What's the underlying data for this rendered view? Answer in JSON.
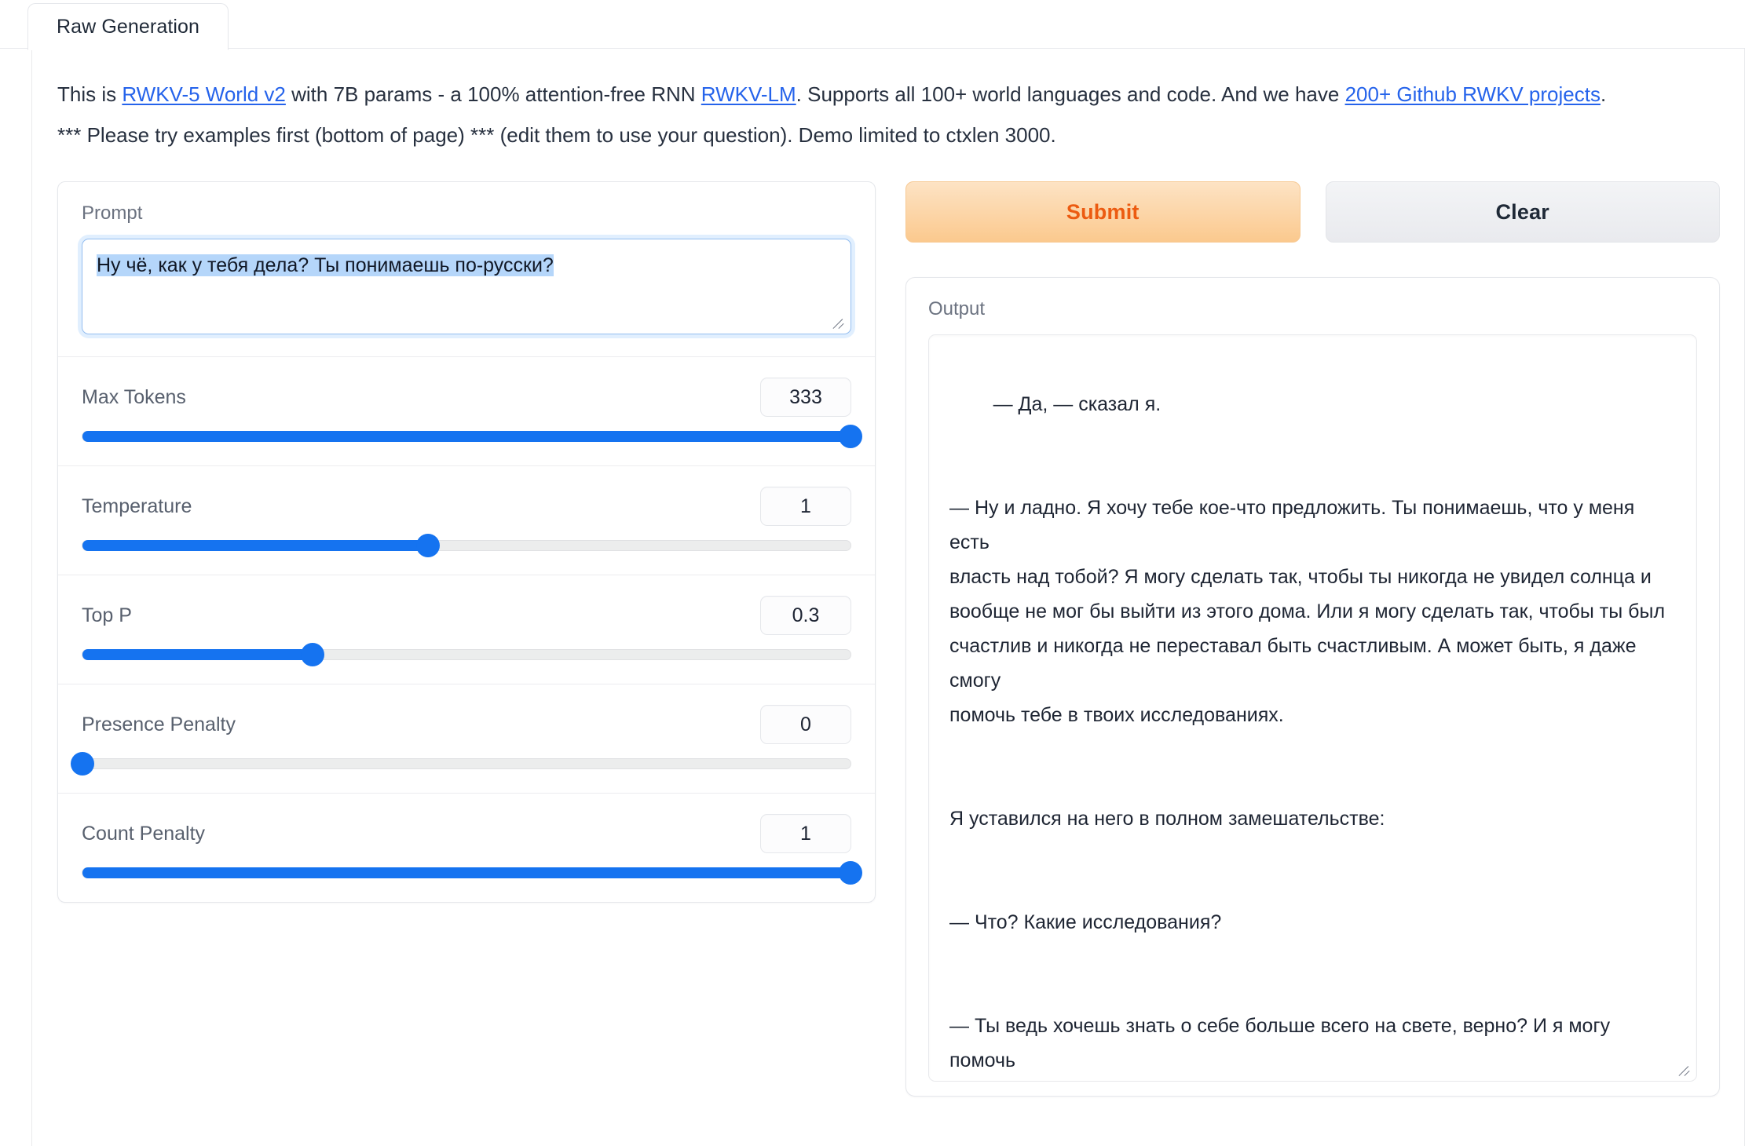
{
  "tabs": [
    {
      "label": "Raw Generation",
      "active": true
    }
  ],
  "intro": {
    "line1_part1": "This is ",
    "link1": "RWKV-5 World v2",
    "line1_part2": " with 7B params - a 100% attention-free RNN ",
    "link2": "RWKV-LM",
    "line1_part3": ". Supports all 100+ world languages and code. And we have ",
    "link3": "200+ Github RWKV projects",
    "line1_part4": ".",
    "line2": "*** Please try examples first (bottom of page) *** (edit them to use your question). Demo limited to ctxlen 3000."
  },
  "prompt": {
    "label": "Prompt",
    "value": "Ну чё, как у тебя дела? Ты понимаешь по-русски?",
    "selected": true
  },
  "sliders": [
    {
      "label": "Max Tokens",
      "value": "333",
      "percent": 100
    },
    {
      "label": "Temperature",
      "value": "1",
      "percent": 45
    },
    {
      "label": "Top P",
      "value": "0.3",
      "percent": 30
    },
    {
      "label": "Presence Penalty",
      "value": "0",
      "percent": 0
    },
    {
      "label": "Count Penalty",
      "value": "1",
      "percent": 100
    }
  ],
  "buttons": {
    "submit": "Submit",
    "clear": "Clear"
  },
  "output": {
    "label": "Output",
    "text": "— Да, — сказал я.\n\n\n— Ну и ладно. Я хочу тебе кое-что предложить. Ты понимаешь, что у меня есть\nвласть над тобой? Я могу сделать так, чтобы ты никогда не увидел солнца и\nвообще не мог бы выйти из этого дома. Или я могу сделать так, чтобы ты был\nсчастлив и никогда не переставал быть счастливым. А может быть, я даже смогу\nпомочь тебе в твоих исследованиях.\n\n\nЯ уставился на него в полном замешательстве:\n\n\n— Что? Какие исследования?\n\n\n— Ты ведь хочешь знать о себе больше всего на свете, верно? И я могу помочь"
  },
  "colors": {
    "accent_blue": "#1573f0",
    "link_blue": "#2563eb",
    "submit_text": "#ec5b11",
    "selection_bg": "#b5d6fa"
  }
}
